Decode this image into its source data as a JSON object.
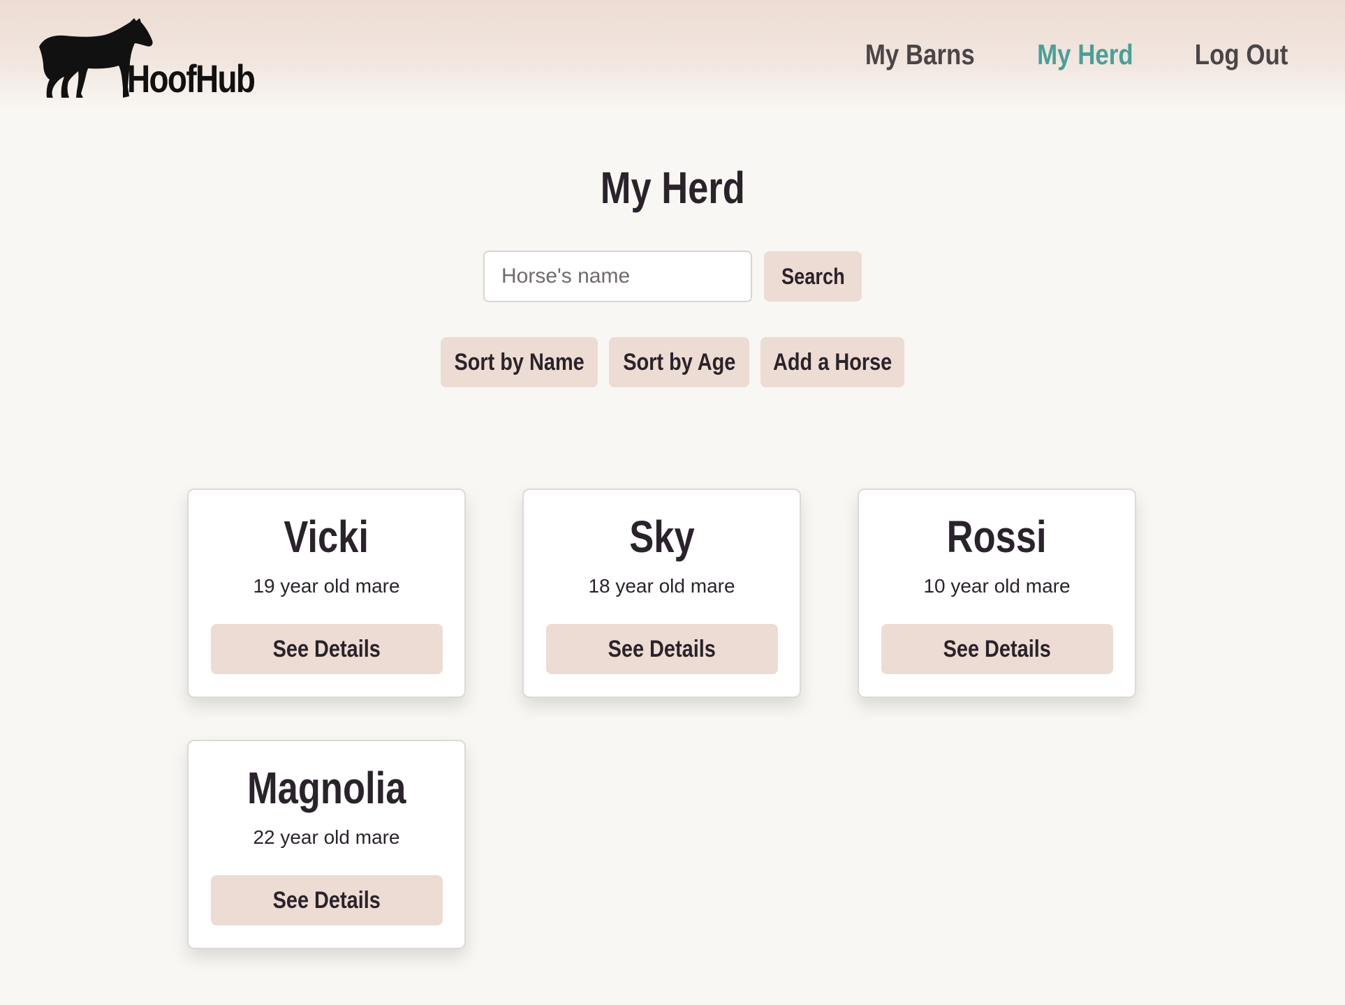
{
  "app": {
    "name": "HoofHub",
    "logo_icon": "horse-silhouette-icon"
  },
  "nav": {
    "items": [
      {
        "label": "My Barns",
        "active": false
      },
      {
        "label": "My Herd",
        "active": true
      },
      {
        "label": "Log Out",
        "active": false
      }
    ]
  },
  "page": {
    "title": "My Herd"
  },
  "search": {
    "placeholder": "Horse's name",
    "value": "",
    "button_label": "Search"
  },
  "actions": {
    "sort_by_name": "Sort by Name",
    "sort_by_age": "Sort by Age",
    "add_horse": "Add a Horse"
  },
  "horses": [
    {
      "name": "Vicki",
      "description": "19 year old mare",
      "button_label": "See Details"
    },
    {
      "name": "Sky",
      "description": "18 year old mare",
      "button_label": "See Details"
    },
    {
      "name": "Rossi",
      "description": "10 year old mare",
      "button_label": "See Details"
    },
    {
      "name": "Magnolia",
      "description": "22 year old mare",
      "button_label": "See Details"
    }
  ],
  "colors": {
    "background": "#f9f7f3",
    "header": "#eddcd3",
    "button": "#eddcd3",
    "accent_active": "#4a9f97",
    "text": "#2a232b",
    "nav_text": "#4a4547"
  }
}
